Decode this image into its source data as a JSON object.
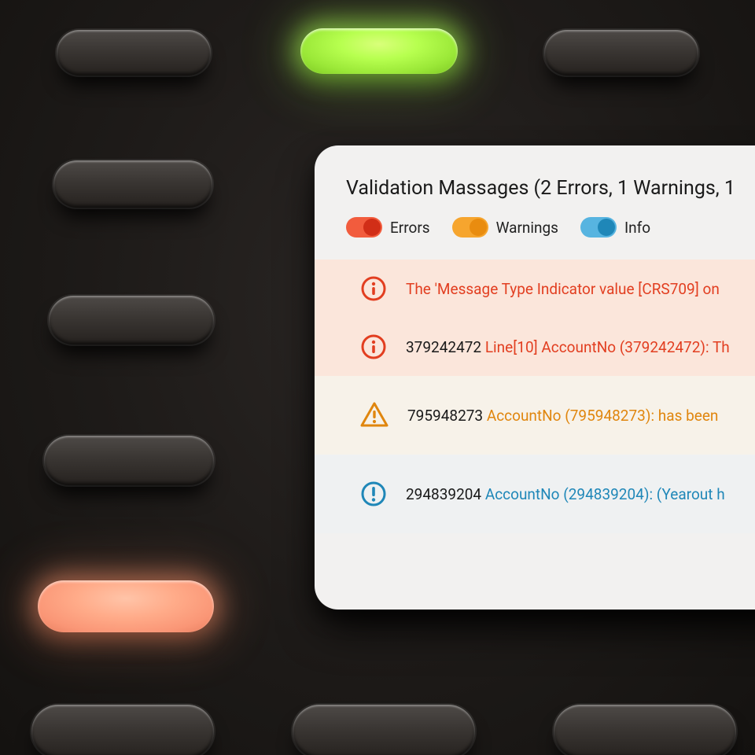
{
  "panel": {
    "title": "Validation Massages (2 Errors, 1 Warnings, 1",
    "toggles": {
      "errors": {
        "label": "Errors",
        "on": true
      },
      "warnings": {
        "label": "Warnings",
        "on": true
      },
      "info": {
        "label": "Info",
        "on": true
      }
    },
    "messages": [
      {
        "type": "error",
        "ref": "",
        "text_hl": "The 'Message Type Indicator value [CRS709] on",
        "text_rest": ""
      },
      {
        "type": "error",
        "ref": "379242472",
        "text_hl": "Line[10] AccountNo (379242472): Th",
        "text_rest": ""
      },
      {
        "type": "warning",
        "ref": "795948273",
        "text_hl": "AccountNo (795948273): has been ",
        "text_rest": ""
      },
      {
        "type": "info",
        "ref": "294839204",
        "text_hl": "AccountNo (294839204): (Yearout h",
        "text_rest": ""
      }
    ]
  },
  "colors": {
    "error": "#e23e20",
    "warning": "#e0860e",
    "info": "#1f87b8"
  }
}
